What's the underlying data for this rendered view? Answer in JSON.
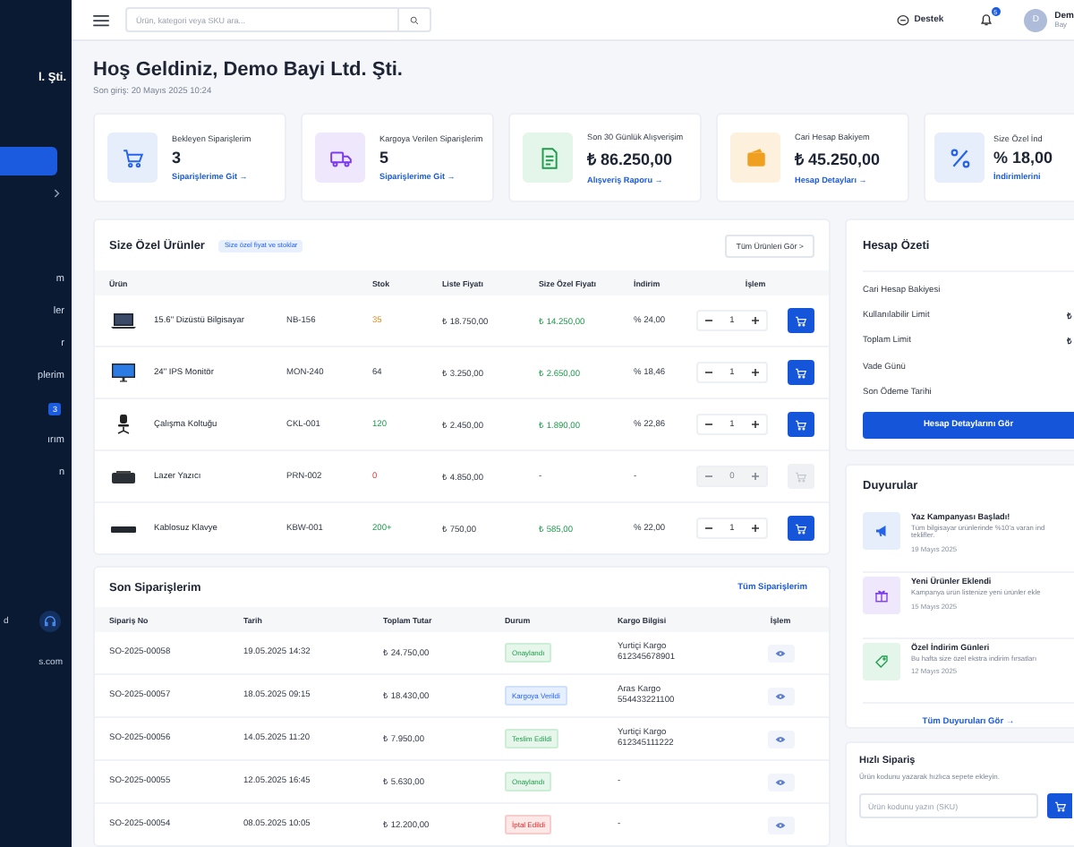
{
  "sidebar": {
    "company": "l. Şti.",
    "items": [
      {
        "selected": true
      },
      {
        "selected": false,
        "expandable": true
      },
      {
        "label": "m",
        "selected": false
      },
      {
        "label": "ler",
        "selected": false
      },
      {
        "label": "r",
        "selected": false
      },
      {
        "label": "plerim",
        "selected": false
      },
      {
        "badge": "3",
        "selected": false
      },
      {
        "label": "ırım",
        "selected": false
      },
      {
        "label": "n",
        "selected": false
      }
    ],
    "support": {
      "label": "d",
      "email": "s.com"
    }
  },
  "topbar": {
    "search": {
      "placeholder": "Ürün, kategori veya SKU ara..."
    },
    "support": "Destek",
    "notifications": "5",
    "user": {
      "initial": "D",
      "name": "Dem",
      "role": "Bay"
    }
  },
  "welcome": {
    "title": "Hoş Geldiniz, Demo Bayi Ltd. Şti.",
    "last_login": "Son giriş: 20 Mayıs 2025 10:24"
  },
  "stats": [
    {
      "kind": "cart",
      "label": "Bekleyen Siparişlerim",
      "value": "3",
      "link": "Siparişlerime Git →"
    },
    {
      "kind": "truck",
      "label": "Kargoya Verilen Siparişlerim",
      "value": "5",
      "link": "Siparişlerime Git →"
    },
    {
      "kind": "receipt",
      "label": "Son 30 Günlük Alışverişim",
      "value": "₺ 86.250,00",
      "link": "Alışveriş Raporu →"
    },
    {
      "kind": "wallet",
      "label": "Cari Hesap Bakiyem",
      "value": "₺ 45.250,00",
      "link": "Hesap Detayları →"
    },
    {
      "kind": "percent",
      "label": "Size Özel İnd",
      "value": "% 18,00",
      "link": "İndirimlerini"
    }
  ],
  "products": {
    "title": "Size Özel Ürünler",
    "tag": "Size özel fiyat ve stoklar",
    "button": "Tüm Ürünleri Gör >",
    "columns": [
      "Ürün",
      "Stok",
      "Liste Fiyatı",
      "Size Özel Fiyatı",
      "İndirim",
      "İşlem"
    ],
    "rows": [
      {
        "kind": "laptop",
        "name": "15.6\" Dizüstü Bilgisayar",
        "sku": "NB-156",
        "stock": {
          "value": "35",
          "kind": "low"
        },
        "list_price": "₺ 18.750,00",
        "special_price": "₺ 14.250,00",
        "discount": "% 24,00",
        "quantity": "1",
        "disabled": false
      },
      {
        "kind": "monitor",
        "name": "24\" IPS Monitör",
        "sku": "MON-240",
        "stock": {
          "value": "64",
          "kind": "normal"
        },
        "list_price": "₺ 3.250,00",
        "special_price": "₺ 2.650,00",
        "discount": "% 18,46",
        "quantity": "1",
        "disabled": false
      },
      {
        "kind": "chair",
        "name": "Çalışma Koltuğu",
        "sku": "CKL-001",
        "stock": {
          "value": "120",
          "kind": "high"
        },
        "list_price": "₺ 2.450,00",
        "special_price": "₺ 1.890,00",
        "discount": "% 22,86",
        "quantity": "1",
        "disabled": false
      },
      {
        "kind": "printer",
        "name": "Lazer Yazıcı",
        "sku": "PRN-002",
        "stock": {
          "value": "0",
          "kind": "out"
        },
        "list_price": "₺ 4.850,00",
        "special_price": "-",
        "discount": "-",
        "quantity": "0",
        "disabled": true
      },
      {
        "kind": "keyboard",
        "name": "Kablosuz Klavye",
        "sku": "KBW-001",
        "stock": {
          "value": "200+",
          "kind": "high"
        },
        "list_price": "₺ 750,00",
        "special_price": "₺ 585,00",
        "discount": "% 22,00",
        "quantity": "1",
        "disabled": false
      }
    ]
  },
  "orders": {
    "title": "Son Siparişlerim",
    "link": "Tüm Siparişlerim",
    "columns": [
      "Sipariş No",
      "Tarih",
      "Toplam Tutar",
      "Durum",
      "Kargo Bilgisi",
      "İşlem"
    ],
    "rows": [
      {
        "number": "SO-2025-00058",
        "date": "19.05.2025 14:32",
        "total": "₺ 24.750,00",
        "status": {
          "kind": "approved",
          "label": "Onaylandı"
        },
        "carrier": "Yurtiçi Kargo",
        "tracking": "612345678901"
      },
      {
        "number": "SO-2025-00057",
        "date": "18.05.2025 09:15",
        "total": "₺ 18.430,00",
        "status": {
          "kind": "shipped",
          "label": "Kargoya Verildi"
        },
        "carrier": "Aras Kargo",
        "tracking": "554433221100"
      },
      {
        "number": "SO-2025-00056",
        "date": "14.05.2025 11:20",
        "total": "₺ 7.950,00",
        "status": {
          "kind": "delivered",
          "label": "Teslim Edildi"
        },
        "carrier": "Yurtiçi Kargo",
        "tracking": "612345111222"
      },
      {
        "number": "SO-2025-00055",
        "date": "12.05.2025 16:45",
        "total": "₺ 5.630,00",
        "status": {
          "kind": "approved",
          "label": "Onaylandı"
        },
        "carrier": "-"
      },
      {
        "number": "SO-2025-00054",
        "date": "08.05.2025 10:05",
        "total": "₺ 12.200,00",
        "status": {
          "kind": "cancelled",
          "label": "İptal Edildi"
        },
        "carrier": "-"
      }
    ]
  },
  "account": {
    "title": "Hesap Özeti",
    "rows": [
      {
        "label": "Cari Hesap Bakiyesi"
      },
      {
        "label": "Kullanılabilir Limit",
        "value": "₺"
      },
      {
        "label": "Toplam Limit",
        "value": "₺"
      },
      {
        "label": "Vade Günü"
      },
      {
        "label": "Son Ödeme Tarihi"
      }
    ],
    "button": "Hesap Detaylarını Gör"
  },
  "announcements": {
    "title": "Duyurular",
    "items": [
      {
        "kind": "megaphone",
        "title": "Yaz Kampanyası Başladı!",
        "text": "Tüm bilgisayar ürünlerinde %10'a varan ind\nteklifler.",
        "date": "19 Mayıs 2025"
      },
      {
        "kind": "gift",
        "title": "Yeni Ürünler Eklendi",
        "text": "Kampanya ürün listenize yeni ürünler ekle",
        "date": "15 Mayıs 2025"
      },
      {
        "kind": "tag",
        "title": "Özel İndirim Günleri",
        "text": "Bu hafta size özel ekstra indirim fırsatları",
        "date": "12 Mayıs 2025"
      }
    ],
    "link": "Tüm Duyuruları Gör →"
  },
  "quick_order": {
    "title": "Hızlı Sipariş",
    "text": "Ürün kodunu yazarak hızlıca sepete ekleyin.",
    "placeholder": "Ürün kodunu yazın (SKU)"
  }
}
